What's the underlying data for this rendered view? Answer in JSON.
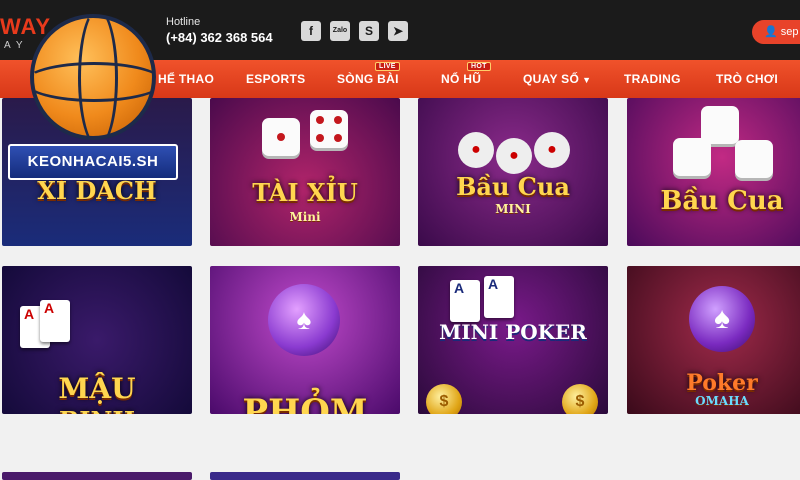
{
  "brand": {
    "logo_text": "WAY",
    "logo_sub": "AY"
  },
  "header": {
    "hotline_label": "Hotline",
    "hotline_number": "(+84) 362 368 564",
    "social": [
      "f",
      "Zalo",
      "S",
      "➤"
    ],
    "login_label": "sep"
  },
  "nav": {
    "items": [
      {
        "label": "HỂ THAO"
      },
      {
        "label": "ESPORTS"
      },
      {
        "label": "SÒNG BÀI",
        "badge": "LIVE"
      },
      {
        "label": "NỔ HŨ",
        "badge": "HOT"
      },
      {
        "label": "QUAY SỐ"
      },
      {
        "label": "TRADING"
      },
      {
        "label": "TRÒ CHƠI"
      }
    ]
  },
  "watermark": {
    "site": "KEONHACAI5.SH"
  },
  "games": [
    {
      "title": "XÌ DÁCH",
      "subtitle": ""
    },
    {
      "title": "TÀI XỈU",
      "subtitle": "Mini"
    },
    {
      "title": "Bầu Cua",
      "subtitle": "MINI"
    },
    {
      "title": "Bầu Cua",
      "subtitle": ""
    },
    {
      "title": "MẬU",
      "subtitle": "BINH"
    },
    {
      "title": "PHỎM",
      "subtitle": ""
    },
    {
      "title": "MINI POKER",
      "subtitle": ""
    },
    {
      "title": "Poker",
      "subtitle": "OMAHA"
    }
  ],
  "colors": {
    "nav_bg": "#e8432a",
    "topbar_bg": "#1b1b1b",
    "accent_gold": "#ffd64f"
  }
}
